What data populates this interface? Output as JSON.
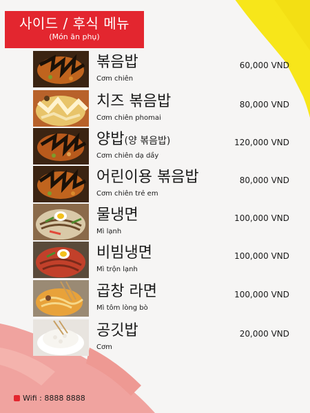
{
  "header": {
    "title_ko": "사이드 / 후식 메뉴",
    "title_vi": "(Món ăn phụ)"
  },
  "items": [
    {
      "name_ko": "볶음밥",
      "name_ko_sub": "",
      "name_vi": "Cơm chiên",
      "price": "60,000 VND",
      "photo": "fried-rice-photo"
    },
    {
      "name_ko": "치즈 볶음밥",
      "name_ko_sub": "",
      "name_vi": "Cơm chiên phomai",
      "price": "80,000 VND",
      "photo": "cheese-fried-rice-photo"
    },
    {
      "name_ko": "양밥",
      "name_ko_sub": "(양 볶음밥)",
      "name_vi": "Cơm chiên dạ dầy",
      "price": "120,000 VND",
      "photo": "tripe-fried-rice-photo"
    },
    {
      "name_ko": "어린이용 볶음밥",
      "name_ko_sub": "",
      "name_vi": "Cơm chiên trẻ em",
      "price": "80,000 VND",
      "photo": "kids-fried-rice-photo"
    },
    {
      "name_ko": "물냉면",
      "name_ko_sub": "",
      "name_vi": "Mì lạnh",
      "price": "100,000 VND",
      "photo": "cold-noodles-photo"
    },
    {
      "name_ko": "비빔냉면",
      "name_ko_sub": "",
      "name_vi": "Mì trộn lạnh",
      "price": "100,000 VND",
      "photo": "spicy-cold-noodles-photo"
    },
    {
      "name_ko": "곱창 라면",
      "name_ko_sub": "",
      "name_vi": "Mì tôm lòng bò",
      "price": "100,000 VND",
      "photo": "tripe-ramen-photo"
    },
    {
      "name_ko": "공깃밥",
      "name_ko_sub": "",
      "name_vi": "Cơm",
      "price": "20,000 VND",
      "photo": "rice-bowl-photo"
    }
  ],
  "footer": {
    "wifi": "Wifi : 8888 8888",
    "wifi_icon": "wifi-badge-icon"
  },
  "colors": {
    "accent_red": "#e3262f",
    "brush_yellow": "#f7e61a",
    "brush_pink": "#f0a39f"
  }
}
